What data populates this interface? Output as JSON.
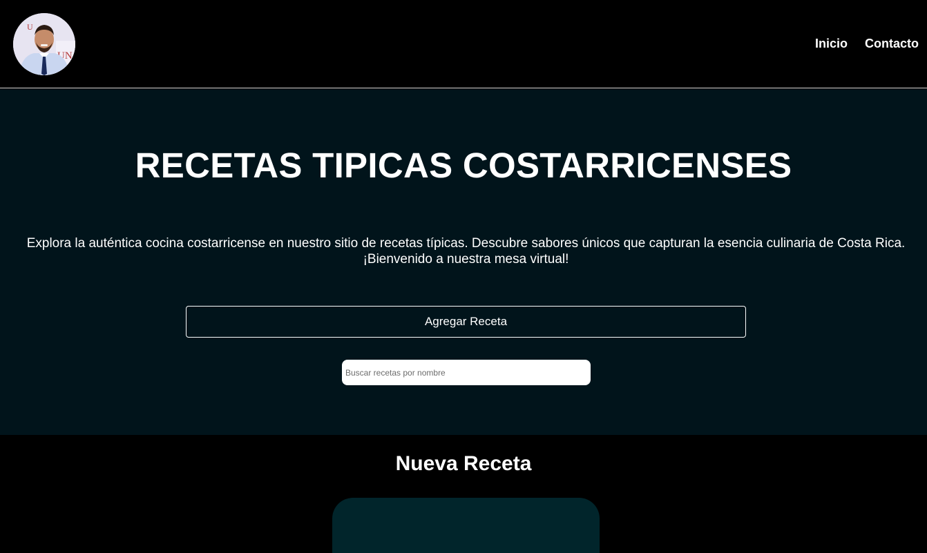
{
  "header": {
    "avatar_alt": "Foto de perfil",
    "nav": [
      {
        "label": "Inicio"
      },
      {
        "label": "Contacto"
      }
    ]
  },
  "hero": {
    "title": "RECETAS TIPICAS COSTARRICENSES",
    "description": "Explora la auténtica cocina costarricense en nuestro sitio de recetas típicas. Descubre sabores únicos que capturan la esencia culinaria de Costa Rica. ¡Bienvenido a nuestra mesa virtual!",
    "add_button_label": "Agregar Receta",
    "search": {
      "placeholder": "Buscar recetas por nombre",
      "value": ""
    }
  },
  "new_recipe": {
    "title": "Nueva Receta"
  },
  "colors": {
    "header_bg": "#000000",
    "hero_bg": "#01141b",
    "card_bg": "#01252b",
    "text": "#ffffff"
  }
}
